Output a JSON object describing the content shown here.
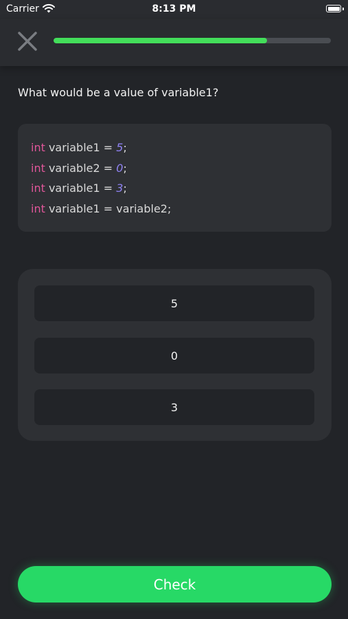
{
  "status_bar": {
    "carrier": "Carrier",
    "time": "8:13 PM",
    "icons": [
      "wifi-icon",
      "battery-icon"
    ]
  },
  "header": {
    "close_icon": "close-icon",
    "progress": 0.77,
    "progress_color": "#43de5a"
  },
  "question": "What would be a value of variable1?",
  "code": {
    "lines": [
      {
        "keyword": "int",
        "text": " variable1 = ",
        "value": "5",
        "end": ";"
      },
      {
        "keyword": "int",
        "text": " variable2 = ",
        "value": "0",
        "end": ";"
      },
      {
        "keyword": "int",
        "text": " variable1 = ",
        "value": "3",
        "end": ";"
      },
      {
        "keyword": "int",
        "text": " variable1 = variable2;",
        "value": "",
        "end": ""
      }
    ],
    "colors": {
      "keyword": "#e0569a",
      "number": "#8f82f2",
      "text": "#d9d9d9"
    }
  },
  "options": [
    "5",
    "0",
    "3"
  ],
  "check_button": {
    "label": "Check",
    "color": "#27d966"
  }
}
